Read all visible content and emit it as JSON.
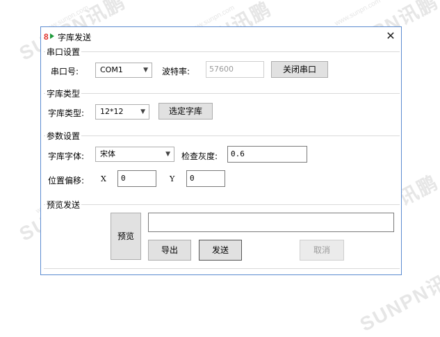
{
  "window": {
    "title": "字库发送",
    "close_glyph": "✕"
  },
  "serial": {
    "legend": "串口设置",
    "port_label": "串口号:",
    "port_value": "COM1",
    "baud_label": "波特率:",
    "baud_value": "57600",
    "close_button": "关闭串口"
  },
  "font_type": {
    "legend": "字库类型",
    "type_label": "字库类型:",
    "type_value": "12*12",
    "select_button": "选定字库"
  },
  "params": {
    "legend": "参数设置",
    "font_label": "字库字体:",
    "font_value": "宋体",
    "gray_label": "检查灰度:",
    "gray_value": "0.6",
    "offset_label": "位置偏移:",
    "x_label": "X",
    "x_value": "0",
    "y_label": "Y",
    "y_value": "0"
  },
  "preview": {
    "legend": "预览发送",
    "preview_button": "预览",
    "export_button": "导出",
    "send_button": "发送",
    "cancel_button": "取消"
  },
  "watermark": {
    "brand": "SUNPN讯鹏",
    "url": "www.sunpn.com"
  },
  "colors": {
    "window_border": "#5b8bd0",
    "button_face": "#e1e1e1",
    "watermark": "#e6e6e6"
  }
}
